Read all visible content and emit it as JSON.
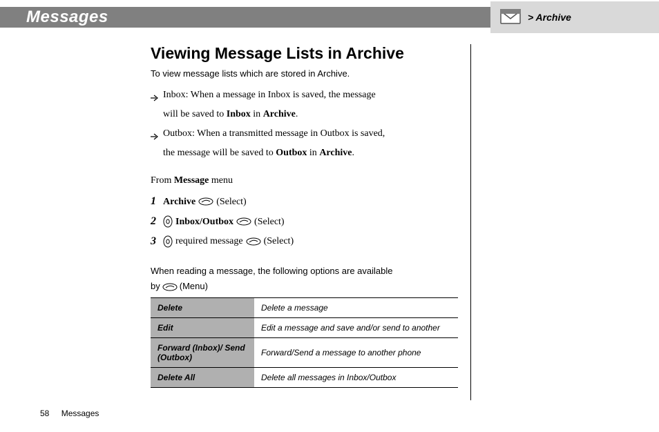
{
  "header": {
    "title": "Messages",
    "crumb": "> Archive"
  },
  "page": {
    "heading": "Viewing Message Lists in Archive",
    "intro": "To view message lists which are stored in Archive."
  },
  "bullets": {
    "inbox_a": "Inbox: When a message in Inbox is saved, the message",
    "inbox_b": "will be saved to ",
    "inbox_bold1": "Inbox",
    "inbox_mid": " in ",
    "inbox_bold2": "Archive",
    "outbox_a": "Outbox: When a transmitted message in Outbox is saved,",
    "outbox_b": "the message will be saved to ",
    "outbox_bold1": "Outbox",
    "outbox_mid": " in ",
    "outbox_bold2": "Archive"
  },
  "from": {
    "pre": "From ",
    "bold": "Message",
    "post": " menu"
  },
  "steps": {
    "s1": {
      "num": "1",
      "bold": "Archive",
      "after": "(Select)"
    },
    "s2": {
      "num": "2",
      "bold": "Inbox/Outbox",
      "after": "(Select)"
    },
    "s3": {
      "num": "3",
      "text": "required message",
      "after": "(Select)"
    }
  },
  "explain": {
    "line1": "When reading a message, the following options are available",
    "by": "by",
    "menu": "(Menu)"
  },
  "options": [
    {
      "k": "Delete",
      "v": "Delete a message"
    },
    {
      "k": "Edit",
      "v": "Edit a message and save and/or send to another"
    },
    {
      "k": "Forward (Inbox)/ Send (Outbox)",
      "v": "Forward/Send a message to another phone"
    },
    {
      "k": "Delete All",
      "v": "Delete all messages in Inbox/Outbox"
    }
  ],
  "footer": {
    "page": "58",
    "section": "Messages"
  }
}
